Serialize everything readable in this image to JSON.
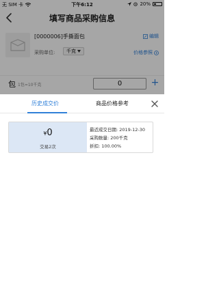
{
  "status_bar": {
    "carrier": "无 SIM 卡",
    "time": "下午6:12",
    "battery": "20%"
  },
  "nav": {
    "title": "填写商品采购信息"
  },
  "product": {
    "name": "[0000006]手撕面包",
    "edit_label": "编辑",
    "unit_label": "采购单位:",
    "unit_value": "千克",
    "price_ref_label": "价格参照"
  },
  "quantity": {
    "unit": "包",
    "conversion": "1包=10千克",
    "value": "0"
  },
  "sheet": {
    "tabs": [
      {
        "label": "历史成交价",
        "active": true
      },
      {
        "label": "商品价格参考",
        "active": false
      }
    ],
    "record": {
      "currency": "¥",
      "price": "0",
      "times": "交易2次",
      "last_date": "最近成交日期: 2019-12-30",
      "quantity": "采购数量: 200千克",
      "discount": "折扣: 100.00%"
    }
  },
  "colors": {
    "accent": "#2f7fd8",
    "record_bg": "#dce7f5"
  }
}
